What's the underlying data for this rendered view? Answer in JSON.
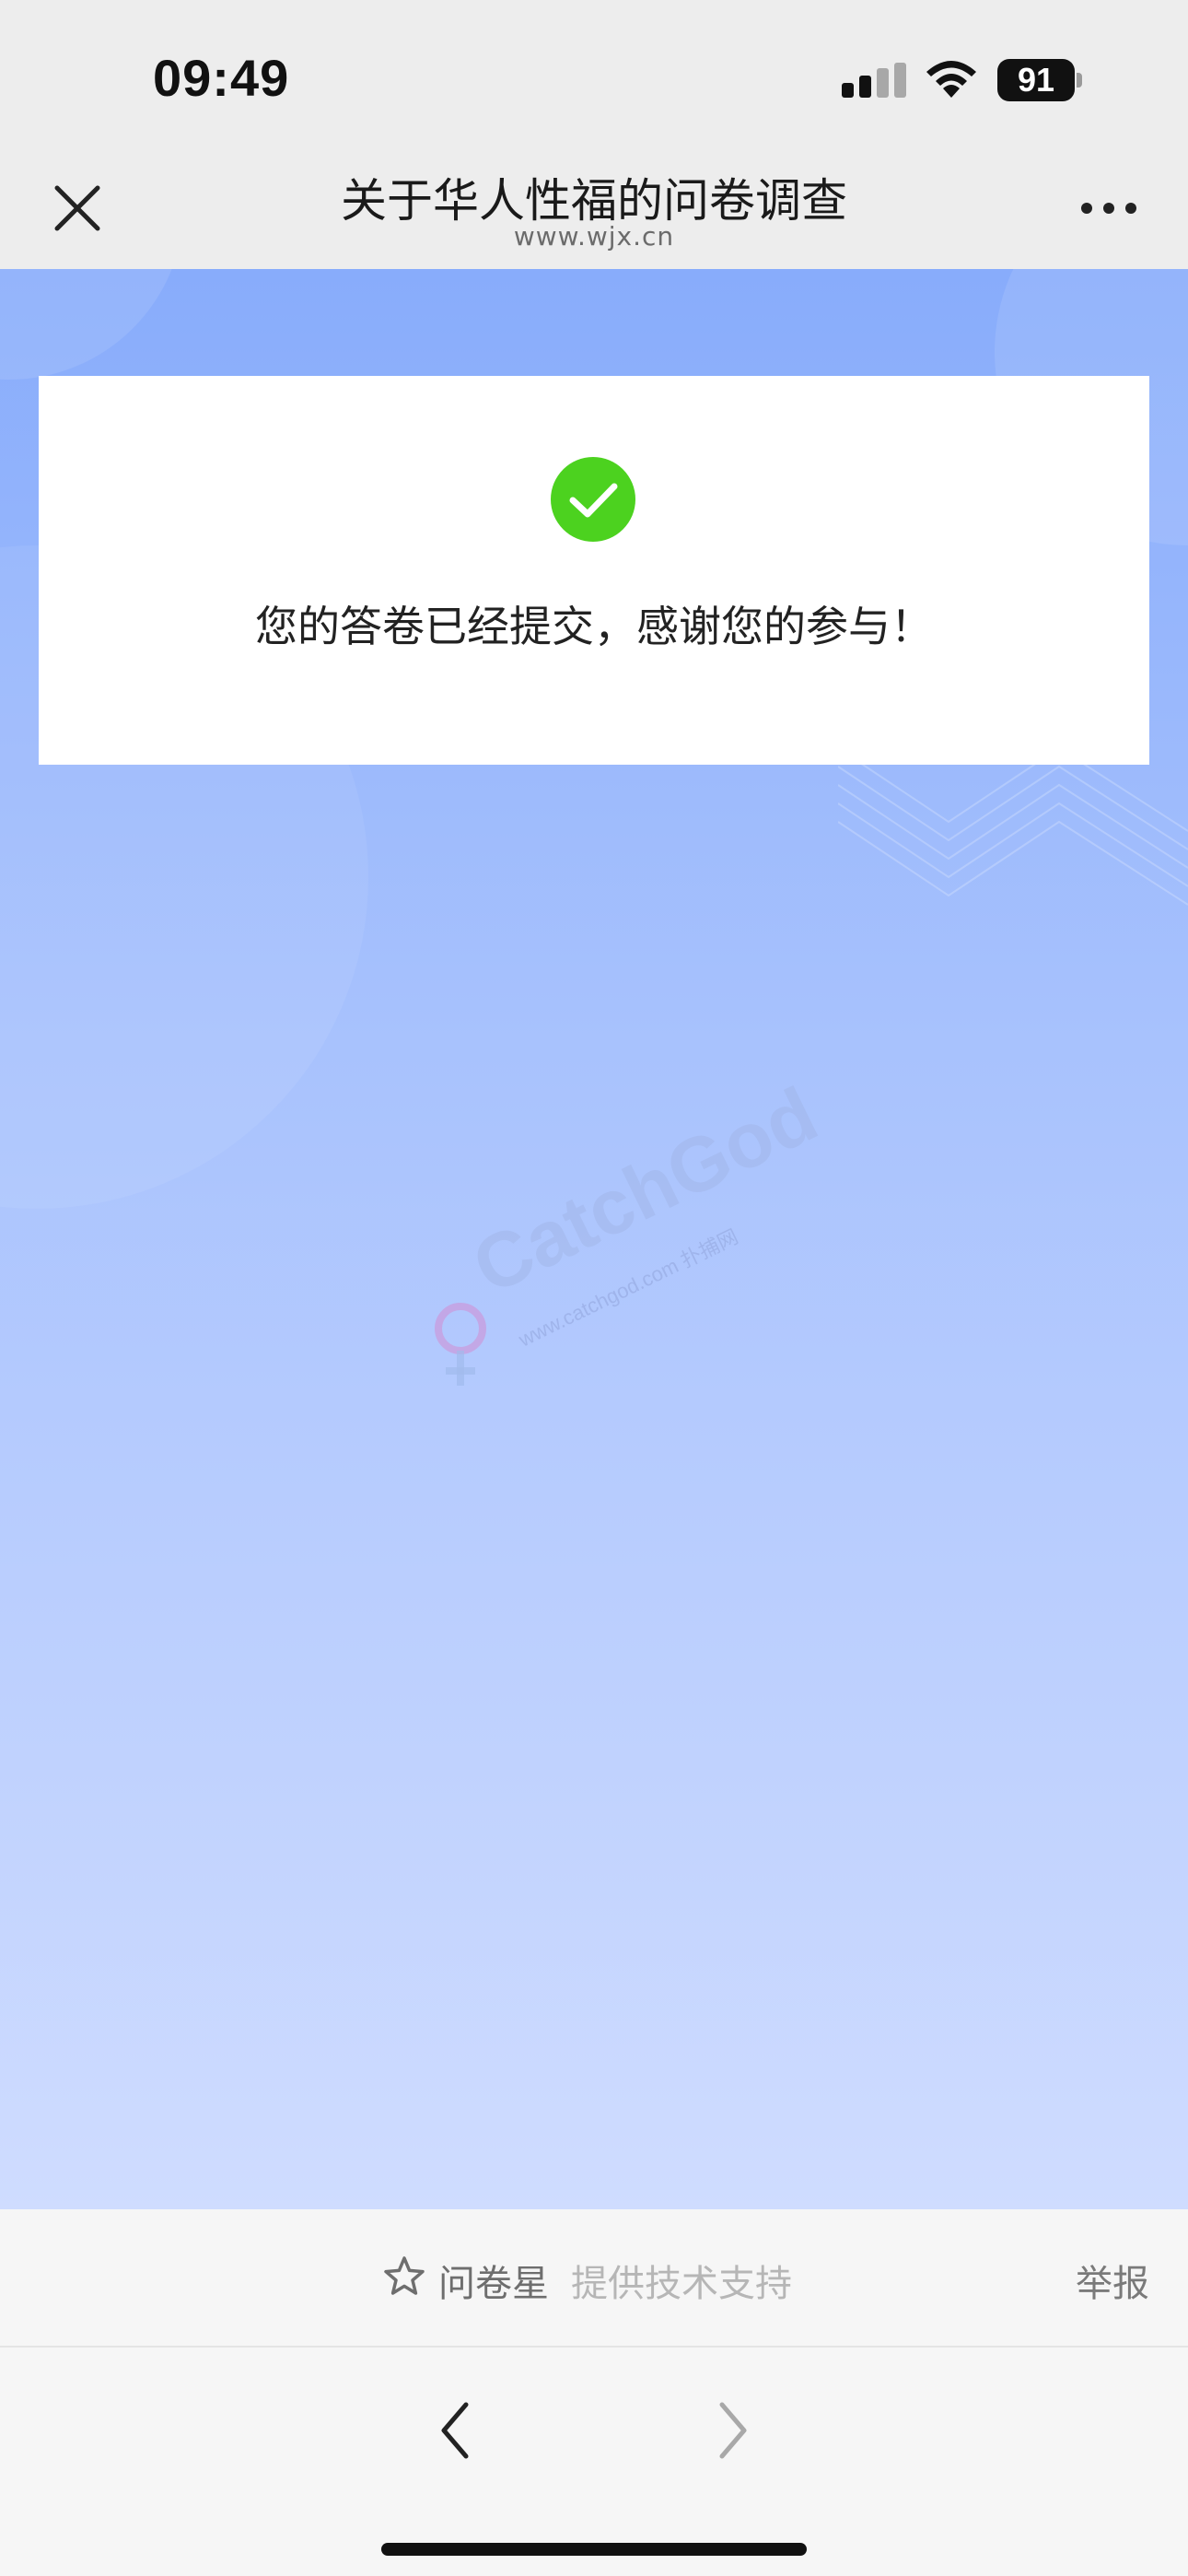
{
  "status_bar": {
    "time": "09:49",
    "battery_level": "91",
    "icons": [
      "cellular-signal-icon",
      "wifi-icon",
      "battery-icon"
    ]
  },
  "nav_bar": {
    "title": "关于华人性福的问卷调查",
    "url": "www.wjx.cn",
    "icons": [
      "close-icon",
      "more-icon"
    ]
  },
  "result": {
    "message": "您的答卷已经提交，感谢您的参与！",
    "icon": "check-circle-icon"
  },
  "watermark": {
    "text": "CatchGod",
    "subtext": "www.catchgod.com 扑捕网"
  },
  "footer": {
    "brand": "问卷星",
    "support": "提供技术支持",
    "report": "举报",
    "icon": "star-outline-icon"
  },
  "toolbar": {
    "icons": [
      "chevron-left-icon",
      "chevron-right-icon"
    ]
  },
  "colors": {
    "success_green": "#4cd21f",
    "gradient_top": "#88acfb",
    "gradient_bottom": "#cfdcff",
    "chrome_bg": "#ededed"
  }
}
